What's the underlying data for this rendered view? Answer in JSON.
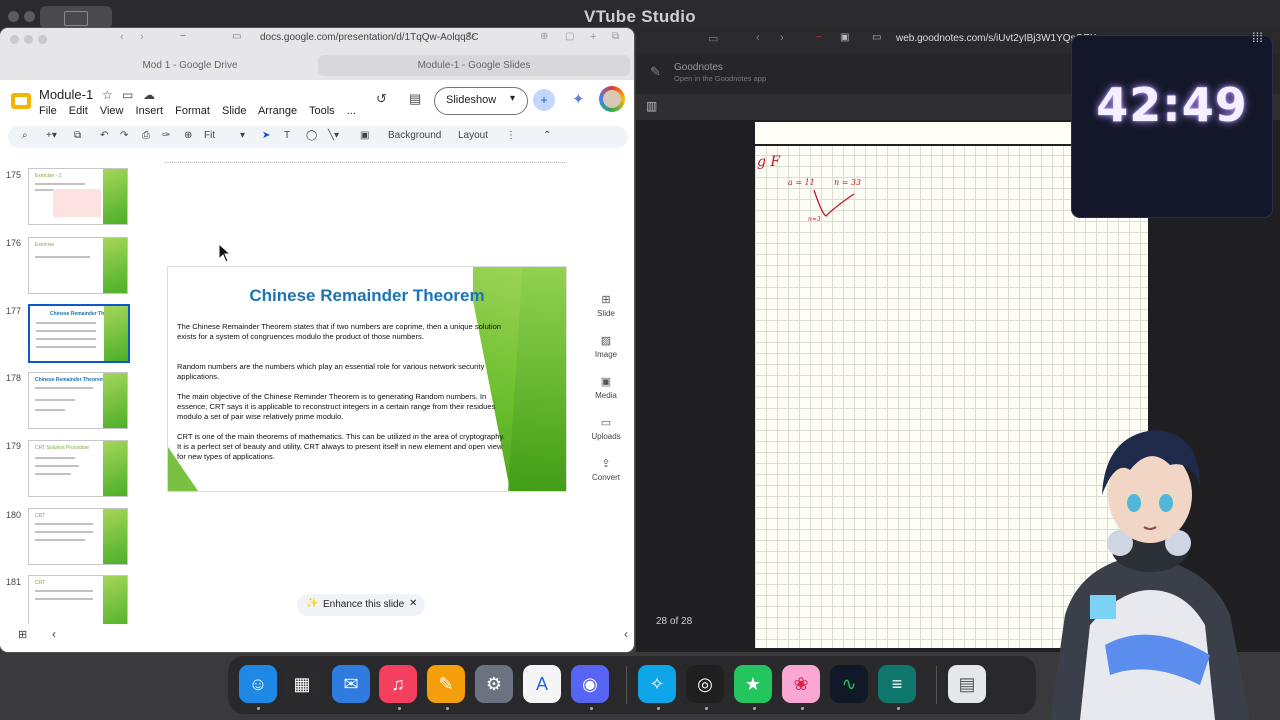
{
  "host": {
    "title": "VTube Studio"
  },
  "left_window": {
    "url": "docs.google.com/presentation/d/1TqQw-Aolqq8C",
    "tabs": [
      {
        "label": "Mod 1 - Google Drive"
      },
      {
        "label": "Module-1 - Google Slides"
      }
    ],
    "doc_title": "Module-1",
    "menu": [
      "File",
      "Edit",
      "View",
      "Insert",
      "Format",
      "Slide",
      "Arrange",
      "Tools",
      "..."
    ],
    "slideshow_label": "Slideshow",
    "toolbar": {
      "zoom": "Fit",
      "background": "Background",
      "layout": "Layout"
    },
    "filmstrip": [
      {
        "num": "175",
        "title": "Exercise - 1"
      },
      {
        "num": "176",
        "title": "Exercise"
      },
      {
        "num": "177",
        "title": "Chinese Remainder Theorem"
      },
      {
        "num": "178",
        "title": "Chinese Remainder Theorem"
      },
      {
        "num": "179",
        "title": "CRT Solution Procedure"
      },
      {
        "num": "180",
        "title": "CRT"
      },
      {
        "num": "181",
        "title": "CRT"
      }
    ],
    "slide": {
      "title": "Chinese Remainder Theorem",
      "p1": "The Chinese Remainder Theorem states that if two numbers are coprime, then a unique solution exists for a system of congruences modulo the product of those numbers.",
      "p2": "Random numbers are the numbers which play an essential role for various network security applications.",
      "p3": "The main objective of the Chinese Reminder Theorem is to generating Random numbers. In essence, CRT says it is applicable to reconstruct integers in a certain range from their residues modulo a set of pair wise relatively prime modulo.",
      "p4": "CRT is one of the main theorems of mathematics. This can be utilized in the area of cryptography.  It is a perfect set of beauty and utility, CRT always to present itself in new element and open view for new types of applications."
    },
    "side_panel": [
      {
        "label": "Slide",
        "icon": "add-slide-icon"
      },
      {
        "label": "Image",
        "icon": "image-icon"
      },
      {
        "label": "Media",
        "icon": "media-icon"
      },
      {
        "label": "Uploads",
        "icon": "folder-icon"
      },
      {
        "label": "Convert",
        "icon": "convert-icon"
      }
    ],
    "enhance_label": "Enhance this slide"
  },
  "right_window": {
    "url": "web.goodnotes.com/s/iUvt2yIBj3W1YQsQEK",
    "app_name": "Goodnotes",
    "app_sub": "Open in the Goodnotes app",
    "page_count": "28 of 28",
    "handwriting": {
      "line1": "g F",
      "a": "a = 11",
      "n": "n = 33",
      "note": "n=3"
    }
  },
  "timer": {
    "value": "42:49"
  },
  "dock": [
    {
      "name": "finder-icon",
      "glyph": "☺",
      "color": "#1e88e5"
    },
    {
      "name": "launchpad-icon",
      "glyph": "▦",
      "color": "#2a2a2c"
    },
    {
      "name": "mail-icon",
      "glyph": "✉",
      "color": "#2f7be0"
    },
    {
      "name": "music-icon",
      "glyph": "♫",
      "color": "#f43f5e"
    },
    {
      "name": "pages-icon",
      "glyph": "✎",
      "color": "#f59e0b"
    },
    {
      "name": "settings-icon",
      "glyph": "⚙",
      "color": "#6b7280"
    },
    {
      "name": "app-store-icon",
      "glyph": "A",
      "color": "#f5f5f5"
    },
    {
      "name": "discord-icon",
      "glyph": "◉",
      "color": "#5865f2"
    },
    {
      "name": "safari-icon",
      "glyph": "✧",
      "color": "#0ea5e9"
    },
    {
      "name": "obs-icon",
      "glyph": "◎",
      "color": "#1f1f1f"
    },
    {
      "name": "sticker-icon",
      "glyph": "★",
      "color": "#22c55e"
    },
    {
      "name": "vtube-icon",
      "glyph": "❀",
      "color": "#f9a8d4"
    },
    {
      "name": "activity-monitor-icon",
      "glyph": "∿",
      "color": "#111827"
    },
    {
      "name": "script-editor-icon",
      "glyph": "≡",
      "color": "#0f766e"
    },
    {
      "name": "downloads-icon",
      "glyph": "▤",
      "color": "#e5e7eb"
    }
  ]
}
